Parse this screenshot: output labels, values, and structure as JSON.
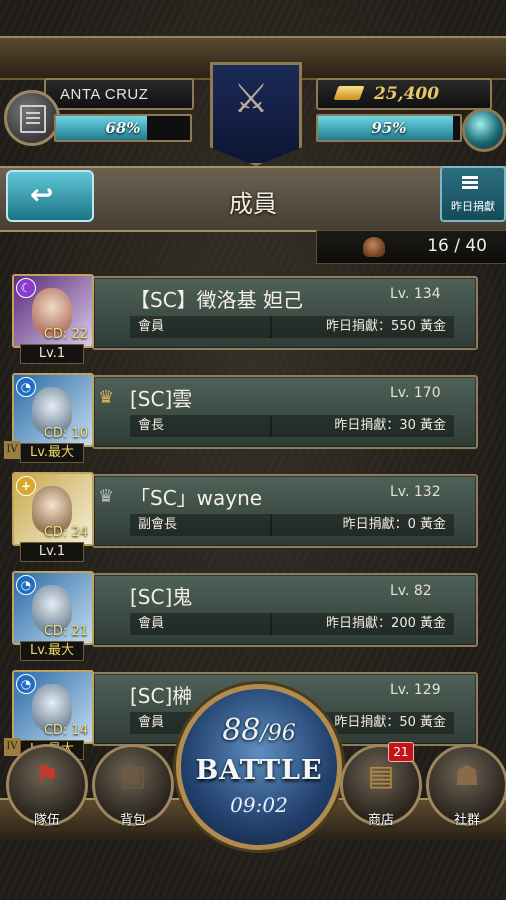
{
  "header": {
    "player_name": "ANTA CRUZ",
    "gold": "25,400",
    "exp_percent": "68%",
    "exp_fill": 0.68,
    "stamina_percent": "95%",
    "stamina_fill": 0.95
  },
  "title_bar": {
    "back_icon": "back-arrow-icon",
    "title": "成員",
    "yesterday_donation_label": "昨日捐獻"
  },
  "member_count": "16 / 40",
  "members": [
    {
      "name": "【SC】徵洛基 妲己",
      "level": "Lv. 134",
      "role": "會員",
      "donation": "昨日捐獻：550 黃金",
      "cd": "CD: 22",
      "card_level": "Lv.1",
      "crown": "",
      "max": false,
      "rank": "",
      "element": "purple"
    },
    {
      "name": "[SC]雲",
      "level": "Lv. 170",
      "role": "會長",
      "donation": "昨日捐獻：30 黃金",
      "cd": "CD: 10",
      "card_level": "Lv.最大",
      "crown": "gold",
      "max": true,
      "rank": "IV",
      "element": "water"
    },
    {
      "name": "「SC」wayne",
      "level": "Lv. 132",
      "role": "副會長",
      "donation": "昨日捐獻：0 黃金",
      "cd": "CD: 24",
      "card_level": "Lv.1",
      "crown": "silver",
      "max": false,
      "rank": "",
      "element": "light"
    },
    {
      "name": "[SC]鬼",
      "level": "Lv. 82",
      "role": "會員",
      "donation": "昨日捐獻：200 黃金",
      "cd": "CD: 21",
      "card_level": "Lv.最大",
      "crown": "",
      "max": true,
      "rank": "",
      "element": "water"
    },
    {
      "name": "[SC]榊",
      "level": "Lv. 129",
      "role": "會員",
      "donation": "昨日捐獻：50 黃金",
      "cd": "CD: 14",
      "card_level": "Lv.最大",
      "crown": "",
      "max": true,
      "rank": "IV",
      "element": "water"
    }
  ],
  "battle": {
    "stamina_current": "88",
    "stamina_max": "/96",
    "label": "BATTLE",
    "timer": "09:02"
  },
  "nav": [
    {
      "label": "隊伍",
      "icon": "flag-icon"
    },
    {
      "label": "背包",
      "icon": "backpack-icon"
    },
    {
      "label": "商店",
      "icon": "treasure-chest-icon",
      "badge": "21"
    },
    {
      "label": "社群",
      "icon": "people-icon"
    }
  ],
  "colors": {
    "accent": "#3aa6b9",
    "gold_text": "#e9c869",
    "badge": "#c01616"
  }
}
